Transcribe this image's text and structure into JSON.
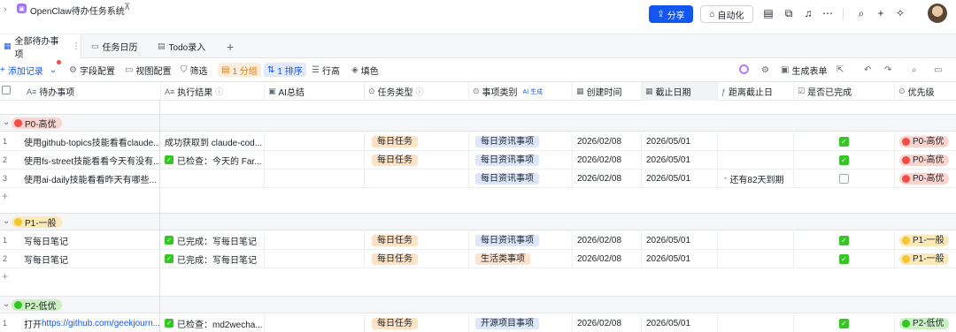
{
  "topbar": {
    "title": "OpenClaw待办任务系统",
    "share_label": "分享",
    "automation_label": "自动化",
    "icons": [
      "chevron-right-icon",
      "pin-icon",
      "table-icon",
      "plugin-icon",
      "bell-icon",
      "more-icon",
      "search-icon",
      "plus-icon",
      "sparkle-icon",
      "avatar"
    ],
    "accent_color": "#1456f0"
  },
  "tabs": [
    {
      "label": "全部待办事项",
      "icon": "grid-icon",
      "active": true
    },
    {
      "label": "任务日历",
      "icon": "calendar-icon",
      "active": false
    },
    {
      "label": "Todo录入",
      "icon": "form-icon",
      "active": false
    }
  ],
  "toolbar": {
    "add_record": "添加记录",
    "field_config": "字段配置",
    "view_config": "视图配置",
    "filter": "筛选",
    "group": "1 分组",
    "sort": "1 排序",
    "row_height": "行高",
    "fill_color": "填色",
    "gen_form": "生成表单"
  },
  "columns": [
    {
      "label": "待办事项",
      "icon": "text-icon"
    },
    {
      "label": "执行结果",
      "icon": "text-icon",
      "info": true
    },
    {
      "label": "AI总结",
      "icon": "image-icon"
    },
    {
      "label": "任务类型",
      "icon": "select-icon",
      "info": true
    },
    {
      "label": "事项类别",
      "icon": "select-icon",
      "ai_tag": "AI 生成"
    },
    {
      "label": "创建时间",
      "icon": "date-icon"
    },
    {
      "label": "截止日期",
      "icon": "date-icon"
    },
    {
      "label": "距离截止日",
      "icon": "formula-icon"
    },
    {
      "label": "是否已完成",
      "icon": "checkbox-icon"
    },
    {
      "label": "优先级",
      "icon": "select-icon"
    }
  ],
  "groups": [
    {
      "label": "P0-高优",
      "dot_color": "#f54a45",
      "pill_bg": "#fbd4d0",
      "rows": [
        {
          "num": "1",
          "todo": "使用github-topics技能看看claude...",
          "result": "成功获取到 claude-cod...",
          "result_check": false,
          "task_type": "每日任务",
          "category": "每日资讯事项",
          "category_style": "blue",
          "created": "2026/02/08",
          "due": "2026/05/01",
          "remaining": "",
          "done": true,
          "priority": "P0-高优"
        },
        {
          "num": "2",
          "todo": "使用fs-street技能看看今天有没有...",
          "result": "已检查：今天的 Far...",
          "result_check": true,
          "task_type": "每日任务",
          "category": "每日资讯事项",
          "category_style": "blue",
          "created": "2026/02/08",
          "due": "2026/05/01",
          "remaining": "",
          "done": true,
          "priority": "P0-高优"
        },
        {
          "num": "3",
          "todo": "使用ai-daily技能看看昨天有哪些...",
          "result": "",
          "result_check": false,
          "task_type": "",
          "category": "每日资讯事项",
          "category_style": "blue",
          "created": "2026/02/08",
          "due": "2026/05/01",
          "remaining": "还有82天到期",
          "done": false,
          "priority": "P0-高优"
        }
      ]
    },
    {
      "label": "P1-一般",
      "dot_color": "#f5c431",
      "pill_bg": "#fbeab7",
      "rows": [
        {
          "num": "1",
          "todo": "写每日笔记",
          "result": "已完成：写每日笔记",
          "result_check": true,
          "task_type": "每日任务",
          "category": "每日资讯事项",
          "category_style": "blue",
          "created": "2026/02/08",
          "due": "2026/05/01",
          "remaining": "",
          "done": true,
          "priority": "P1-一般"
        },
        {
          "num": "2",
          "todo": "写每日笔记",
          "result": "已完成：写每日笔记",
          "result_check": true,
          "task_type": "每日任务",
          "category": "生活类事项",
          "category_style": "peach",
          "created": "2026/02/08",
          "due": "2026/05/01",
          "remaining": "",
          "done": true,
          "priority": "P1-一般"
        }
      ]
    },
    {
      "label": "P2-低优",
      "dot_color": "#34c724",
      "pill_bg": "#c9efc2",
      "rows": [
        {
          "num": "1",
          "todo_prefix": "打开",
          "todo_link": "https://github.com/geekjourn...",
          "todo": "",
          "result": "已检查：md2wecha...",
          "result_check": true,
          "task_type": "每日任务",
          "category": "开源项目事项",
          "category_style": "blue",
          "created": "2026/02/08",
          "due": "2026/05/01",
          "remaining": "",
          "done": true,
          "priority": "P2-低优"
        }
      ]
    }
  ]
}
